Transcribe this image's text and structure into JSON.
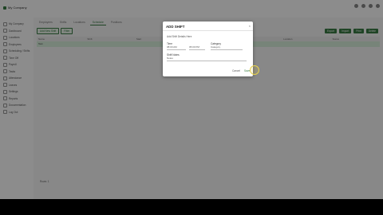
{
  "topbar": {
    "app_name": "My Company",
    "right_items": [
      "",
      "",
      "",
      ""
    ]
  },
  "sidebar": {
    "items": [
      {
        "label": "My Company",
        "icon": "home-icon"
      },
      {
        "label": "Dashboard",
        "icon": "grid-icon"
      },
      {
        "label": "Locations",
        "icon": "pin-icon"
      },
      {
        "label": "Employees",
        "icon": "people-icon"
      },
      {
        "label": "Scheduling / Shifts",
        "icon": "calendar-icon"
      },
      {
        "label": "Time Off",
        "icon": "clock-icon"
      },
      {
        "label": "Payroll",
        "icon": "money-icon"
      },
      {
        "label": "Tasks",
        "icon": "check-icon"
      },
      {
        "label": "Attendance",
        "icon": "list-icon"
      },
      {
        "label": "Leaves",
        "icon": "leaf-icon"
      },
      {
        "label": "Settings",
        "icon": "gear-icon"
      },
      {
        "label": "Reports",
        "icon": "chart-icon"
      },
      {
        "label": "Documentation",
        "icon": "doc-icon"
      },
      {
        "label": "Log Out",
        "icon": "logout-icon"
      }
    ]
  },
  "main": {
    "tabs": [
      "Employees",
      "Shifts",
      "Locations",
      "Schedule",
      "Positions"
    ],
    "toolbar": {
      "primary": "Add New Shift",
      "secondary": "Filter"
    },
    "right_buttons": [
      "Export",
      "Import",
      "Print",
      "Delete"
    ],
    "table_headers": [
      "Name",
      "Shift",
      "Start",
      "End",
      "Break",
      "Location",
      "Status"
    ],
    "row": [
      "Test",
      "",
      "",
      "",
      "",
      "",
      ""
    ],
    "footer": "Rows: 1"
  },
  "dialog": {
    "title": "ADD SHIFT",
    "close": "×",
    "line": "Add Shift Details Here",
    "time_label": "Time",
    "start_value": "08:00 AM",
    "end_value": "05:00 PM",
    "category_label": "Category",
    "category_value": "Category",
    "notes_label": "Shift Notes",
    "notes_value": "Notes",
    "cancel": "Cancel",
    "save": "Save"
  },
  "colors": {
    "accent": "#3a7d44",
    "overlay": "rgba(0,0,0,0.45)"
  }
}
